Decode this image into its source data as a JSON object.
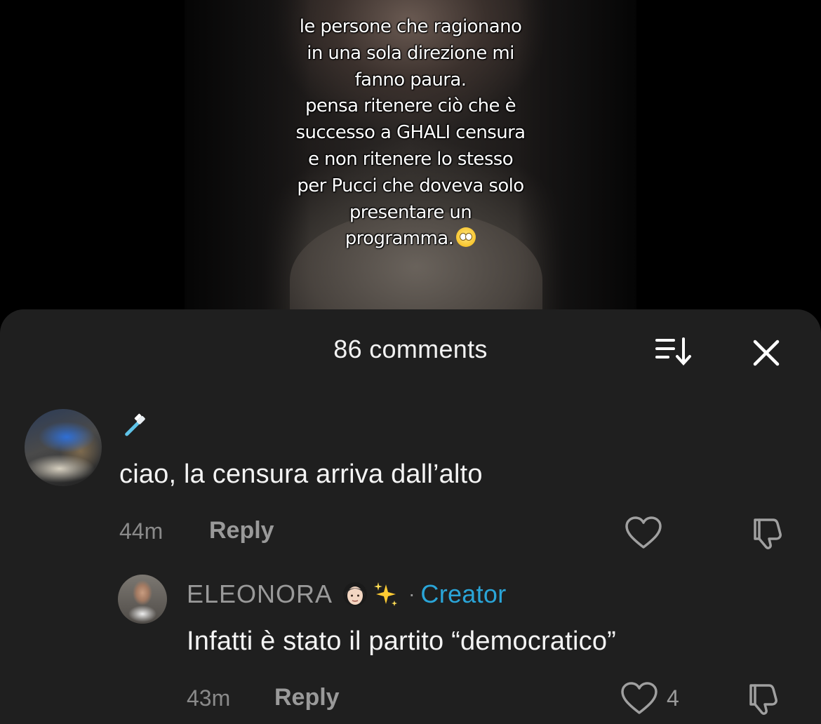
{
  "video": {
    "overlay_lines": [
      "le persone che ragionano",
      "in una sola direzione mi",
      "fanno paura.",
      "pensa ritenere ciò che è",
      "successo a GHALI censura",
      "e non ritenere lo stesso",
      "per Pucci che doveva solo",
      "presentare un",
      "programma."
    ],
    "emoji": "face-with-rolling-eyes"
  },
  "sheet": {
    "title": "86 comments",
    "icons": {
      "sort": "sort-icon",
      "close": "close-icon"
    }
  },
  "comments": [
    {
      "username_emoji": "toothbrush",
      "avatar": "avatar",
      "text": "ciao, la censura arriva dall’alto",
      "time": "44m",
      "reply_label": "Reply",
      "like_count": ""
    },
    {
      "username": "ELEONORA",
      "username_emojis": [
        "woman-light-skin-tone",
        "sparkles"
      ],
      "separator": "·",
      "badge": "Creator",
      "badge_color": "#2aa5d8",
      "avatar": "avatar",
      "text": "Infatti è stato il partito “democratico”",
      "time": "43m",
      "reply_label": "Reply",
      "like_count": "4"
    }
  ]
}
